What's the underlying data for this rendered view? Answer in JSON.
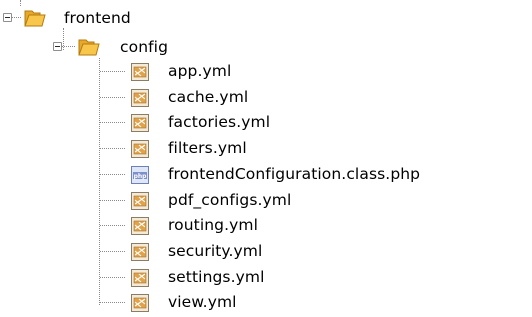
{
  "tree": {
    "root": {
      "label": "frontend",
      "icon": "folder-icon",
      "expanded": true,
      "children": [
        {
          "label": "config",
          "icon": "folder-icon",
          "expanded": true,
          "files": [
            {
              "label": "app.yml",
              "icon": "yml-file-icon"
            },
            {
              "label": "cache.yml",
              "icon": "yml-file-icon"
            },
            {
              "label": "factories.yml",
              "icon": "yml-file-icon"
            },
            {
              "label": "filters.yml",
              "icon": "yml-file-icon"
            },
            {
              "label": "frontendConfiguration.class.php",
              "icon": "php-file-icon"
            },
            {
              "label": "pdf_configs.yml",
              "icon": "yml-file-icon"
            },
            {
              "label": "routing.yml",
              "icon": "yml-file-icon"
            },
            {
              "label": "security.yml",
              "icon": "yml-file-icon"
            },
            {
              "label": "settings.yml",
              "icon": "yml-file-icon"
            },
            {
              "label": "view.yml",
              "icon": "yml-file-icon"
            }
          ]
        }
      ]
    }
  },
  "colors": {
    "folder": "#f0b030",
    "folder_dark": "#c98a10",
    "yml_icon": "#d89a40",
    "php_icon": "#6c7fbe",
    "connector": "#8a8a8a"
  }
}
